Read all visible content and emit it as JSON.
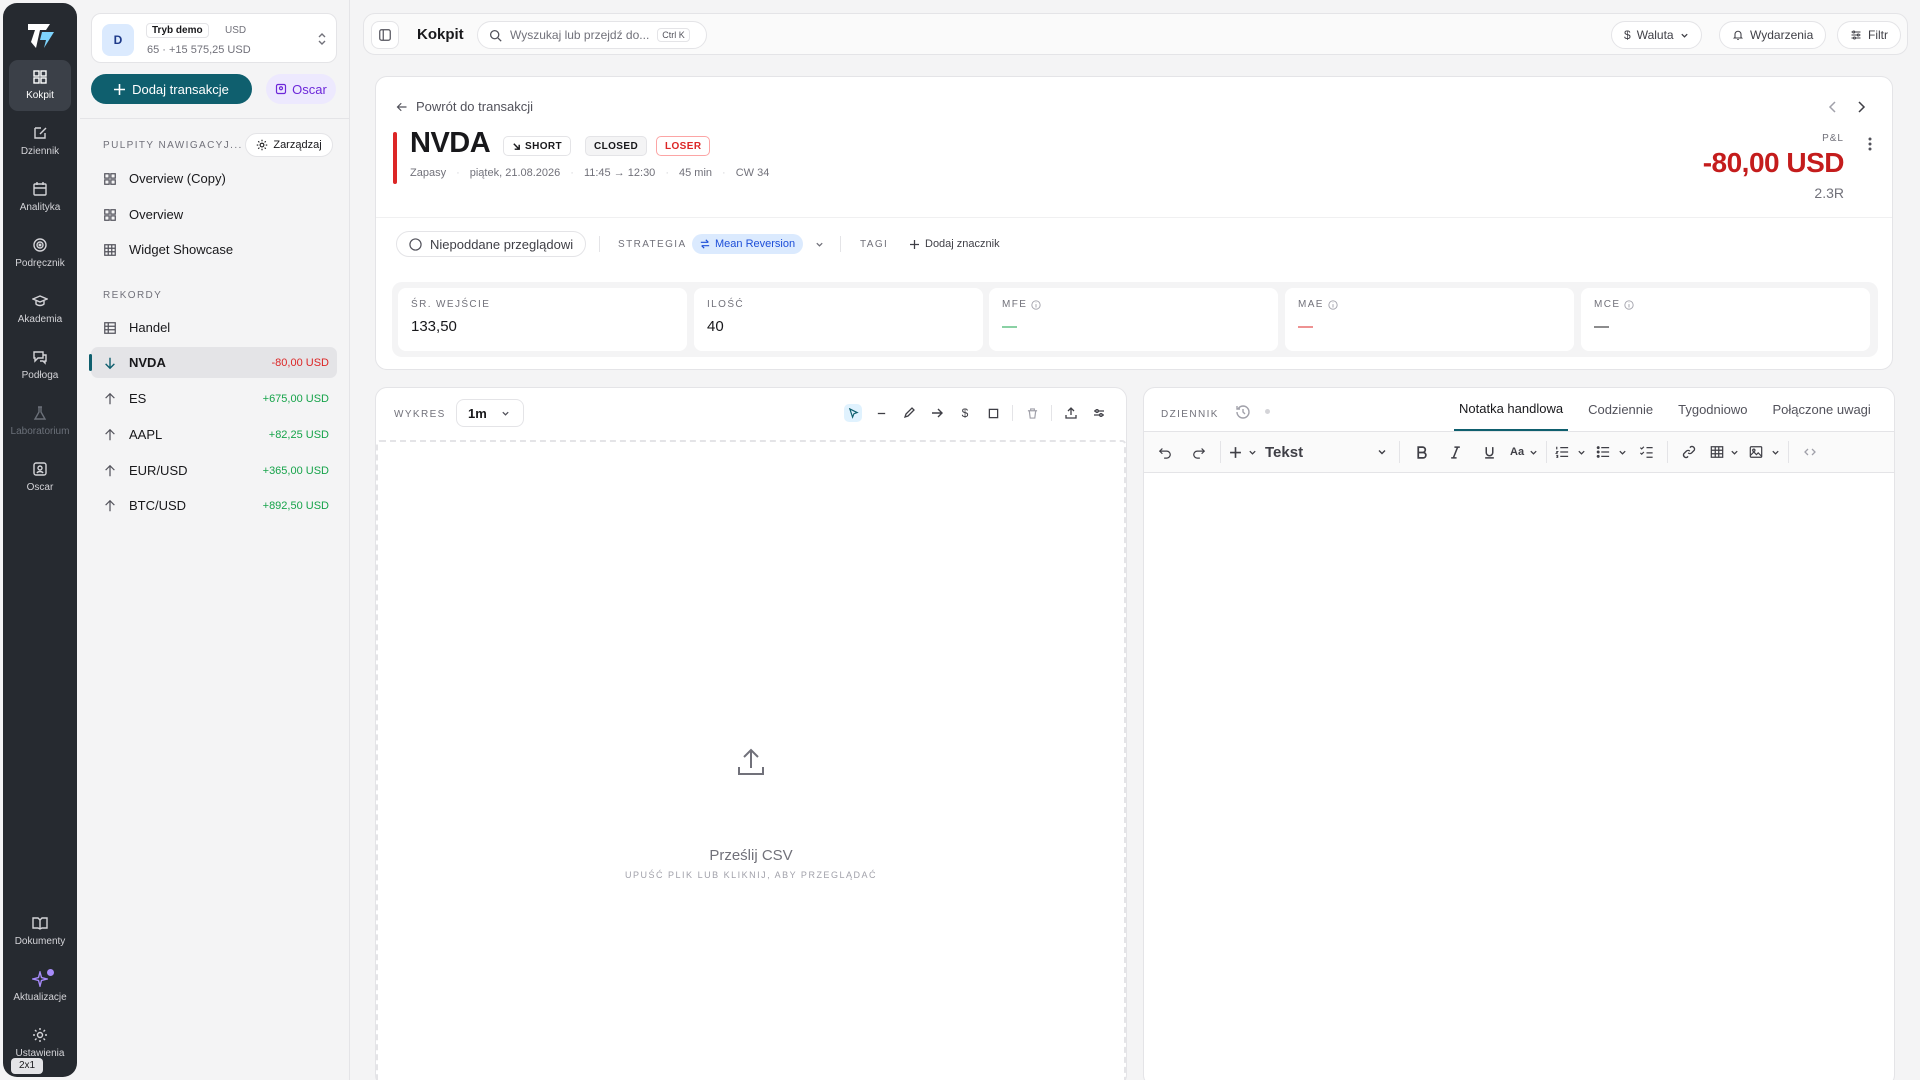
{
  "rail": {
    "items": [
      {
        "label": "Kokpit"
      },
      {
        "label": "Dziennik"
      },
      {
        "label": "Analityka"
      },
      {
        "label": "Podręcznik"
      },
      {
        "label": "Akademia"
      },
      {
        "label": "Podłoga"
      },
      {
        "label": "Laboratorium"
      },
      {
        "label": "Oscar"
      }
    ],
    "bottom": [
      {
        "label": "Dokumenty"
      },
      {
        "label": "Aktualizacje"
      },
      {
        "label": "Ustawienia"
      }
    ],
    "zoom_badge": "2x1"
  },
  "account": {
    "initial": "D",
    "mode": "Tryb demo",
    "currency": "USD",
    "balance": "65 · +15 575,25 USD"
  },
  "sidebar": {
    "add_trade": "Dodaj transakcje",
    "oscar": "Oscar",
    "dashboards_title": "PULPITY NAWIGACYJ...",
    "manage": "Zarządzaj",
    "dashboards": [
      {
        "label": "Overview (Copy)"
      },
      {
        "label": "Overview"
      },
      {
        "label": "Widget Showcase"
      }
    ],
    "records_title": "REKORDY",
    "records": [
      {
        "label": "Handel",
        "pnl": ""
      },
      {
        "label": "NVDA",
        "pnl": "-80,00 USD"
      },
      {
        "label": "ES",
        "pnl": "+675,00 USD"
      },
      {
        "label": "AAPL",
        "pnl": "+82,25 USD"
      },
      {
        "label": "EUR/USD",
        "pnl": "+365,00 USD"
      },
      {
        "label": "BTC/USD",
        "pnl": "+892,50 USD"
      }
    ]
  },
  "topbar": {
    "title": "Kokpit",
    "search_placeholder": "Wyszukaj lub przejdź do...",
    "shortcut": "Ctrl K",
    "currency": "Waluta",
    "events": "Wydarzenia",
    "filter": "Filtr"
  },
  "trade": {
    "back": "Powrót do transakcji",
    "symbol": "NVDA",
    "side": "SHORT",
    "status": "CLOSED",
    "result": "LOSER",
    "meta": {
      "asset": "Zapasy",
      "date": "piątek, 21.08.2026",
      "time": "11:45 → 12:30",
      "duration": "45 min",
      "week": "CW 34"
    },
    "pnl_label": "P&L",
    "pnl": "-80,00 USD",
    "r_multiple": "2.3R",
    "review": "Niepoddane przeglądowi",
    "strategy_label": "STRATEGIA",
    "strategy": "Mean Reversion",
    "tags_label": "TAGI",
    "add_tag": "Dodaj znacznik",
    "stats": [
      {
        "label": "ŚR. WEJŚCIE",
        "value": "133,50"
      },
      {
        "label": "ILOŚĆ",
        "value": "40"
      },
      {
        "label": "MFE",
        "value": "—"
      },
      {
        "label": "MAE",
        "value": "—"
      },
      {
        "label": "MCE",
        "value": "—"
      }
    ]
  },
  "chart_panel": {
    "label": "WYKRES",
    "timeframe": "1m",
    "upload_title": "Prześlij CSV",
    "upload_sub": "UPUŚĆ PLIK LUB KLIKNIJ, ABY PRZEGLĄDAĆ"
  },
  "journal": {
    "label": "DZIENNIK",
    "tabs": [
      "Notatka handlowa",
      "Codziennie",
      "Tygodniowo",
      "Połączone uwagi"
    ],
    "block_type": "Tekst",
    "text_size": "Aa"
  },
  "colors": {
    "accent": "#0f5f6e",
    "loss": "#dc2626",
    "gain": "#16a34a",
    "rail": "#262a30"
  }
}
